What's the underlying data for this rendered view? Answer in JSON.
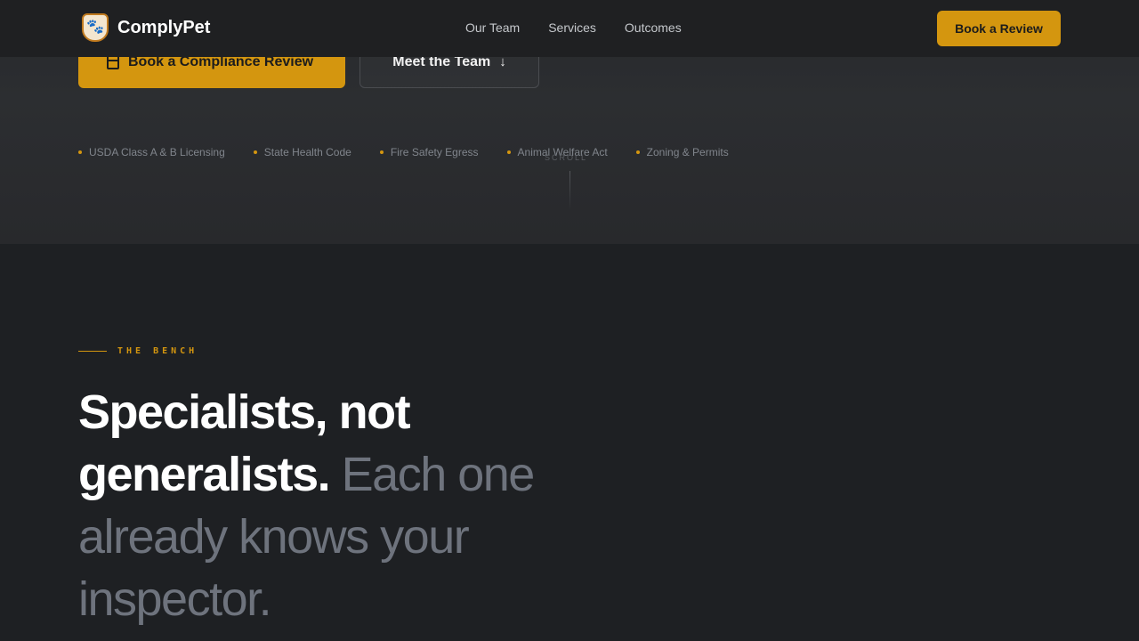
{
  "nav": {
    "brand": "ComplyPet",
    "links": [
      "Our Team",
      "Services",
      "Outcomes"
    ],
    "cta_label": "Book a Review"
  },
  "hero": {
    "primary_cta": "Book a Compliance Review",
    "secondary_cta": "Meet the Team",
    "tags": [
      "USDA Class A & B Licensing",
      "State Health Code",
      "Fire Safety Egress",
      "Animal Welfare Act",
      "Zoning & Permits"
    ],
    "scroll_hint": "SCROLL"
  },
  "bench": {
    "eyebrow": "THE BENCH",
    "headline_strong": "Specialists, not generalists.",
    "headline_muted": "Each one already knows your inspector."
  },
  "colors": {
    "accent": "#d4960f",
    "background": "#1e2023",
    "muted_text": "#6e737d"
  }
}
